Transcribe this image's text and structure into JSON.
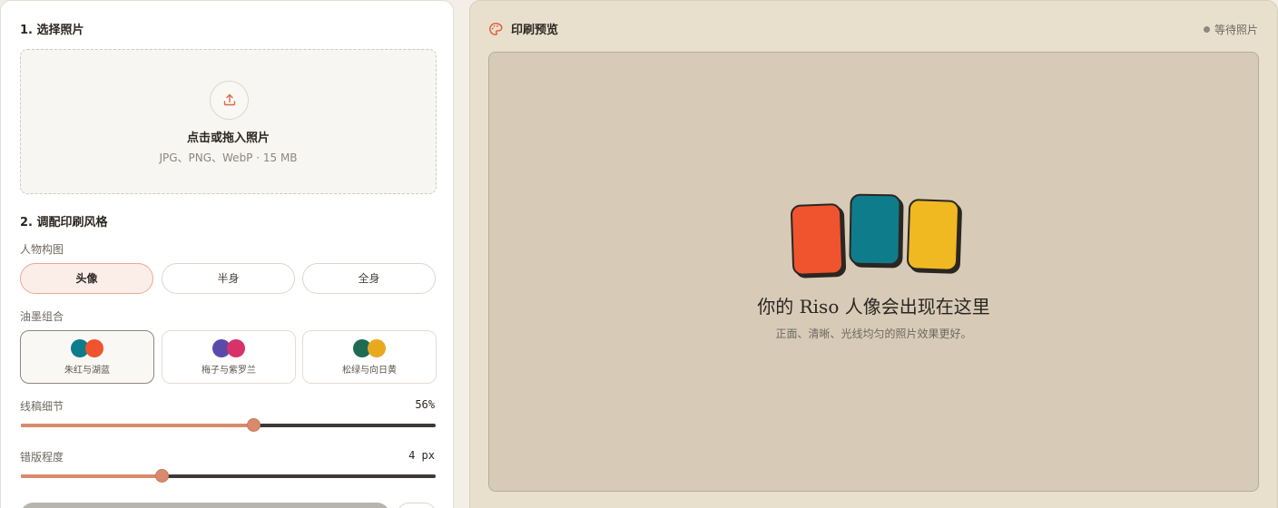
{
  "left": {
    "step1_title": "1. 选择照片",
    "upload": {
      "title": "点击或拖入照片",
      "hint": "JPG、PNG、WebP · 15 MB"
    },
    "step2_title": "2. 调配印刷风格",
    "composition": {
      "label": "人物构图",
      "options": [
        "头像",
        "半身",
        "全身"
      ],
      "selected": "头像"
    },
    "ink": {
      "label": "油墨组合",
      "options": [
        {
          "name": "朱红与湖蓝",
          "colors": [
            "#0f7c8c",
            "#f0542e"
          ]
        },
        {
          "name": "梅子与紫罗兰",
          "colors": [
            "#5a4bab",
            "#d8326a"
          ]
        },
        {
          "name": "松绿与向日黄",
          "colors": [
            "#1d6b52",
            "#e8a91e"
          ]
        }
      ],
      "selected": "朱红与湖蓝"
    },
    "line_detail": {
      "label": "线稿细节",
      "value_text": "56%",
      "value": 0.56
    },
    "misregistration": {
      "label": "错版程度",
      "value_text": "4 px",
      "value": 0.34
    }
  },
  "right": {
    "title": "印刷预览",
    "status": "等待照片",
    "placeholder": {
      "title": "你的 Riso 人像会出现在这里",
      "hint": "正面、清晰、光线均匀的照片效果更好。"
    },
    "swatch_colors": [
      "#f0542e",
      "#0f7c8c",
      "#f0b922"
    ]
  },
  "colors": {
    "accent": "#d98a6c",
    "page_bg": "#f4efe6",
    "preview_bg": "#e8dfcd",
    "canvas_bg": "#d7cbb8"
  }
}
